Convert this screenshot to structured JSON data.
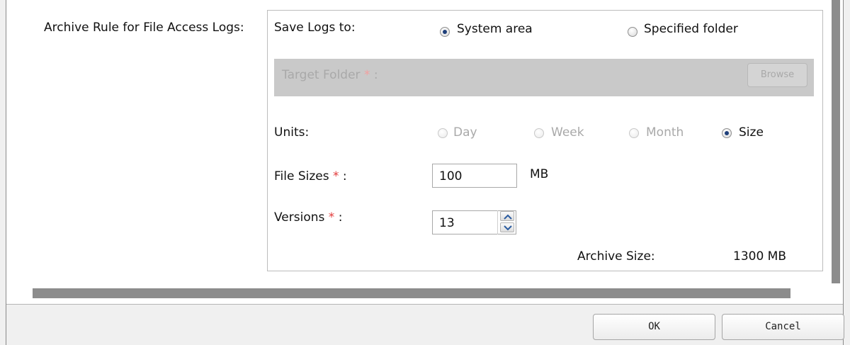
{
  "rule_label": "Archive Rule for File Access Logs:",
  "save_logs": {
    "label": "Save Logs to:",
    "options": [
      "System area",
      "Specified folder"
    ],
    "selected": "System area"
  },
  "target_folder": {
    "label": "Target Folder",
    "required_mark": "*",
    "suffix": ":",
    "browse_label": "Browse"
  },
  "units": {
    "label": "Units:",
    "options": [
      "Day",
      "Week",
      "Month",
      "Size"
    ],
    "selected": "Size"
  },
  "file_sizes": {
    "label": "File Sizes",
    "required_mark": "*",
    "suffix": ":",
    "value": "100",
    "unit": "MB"
  },
  "versions": {
    "label": "Versions",
    "required_mark": "*",
    "suffix": ":",
    "value": "13"
  },
  "archive_size": {
    "label": "Archive Size:",
    "value": "1300 MB"
  },
  "buttons": {
    "ok": "OK",
    "cancel": "Cancel"
  },
  "colors": {
    "required": "#e23b3b",
    "disabled_band": "#c9c9c9",
    "radio_dot": "#1e3f7a"
  },
  "icons": [
    "radio-checked-icon",
    "radio-unchecked-icon",
    "spinner-up-icon",
    "spinner-down-icon"
  ]
}
